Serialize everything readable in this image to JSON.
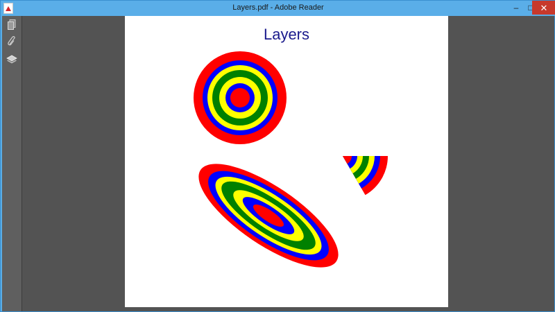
{
  "window": {
    "title": "Layers.pdf - Adobe Reader",
    "minimize_icon": "minimize-icon",
    "maximize_icon": "maximize-icon",
    "close_icon": "close-icon",
    "min_glyph": "–",
    "max_glyph": "□",
    "close_glyph": "✕"
  },
  "left_panel": {
    "buttons": [
      {
        "name": "page-thumbnails",
        "icon": "pages-icon"
      },
      {
        "name": "attachments",
        "icon": "paperclip-icon"
      },
      {
        "name": "layers",
        "icon": "layers-icon"
      }
    ]
  },
  "document": {
    "title": "Layers",
    "ring_colors": [
      "#ff0000",
      "#0000ff",
      "#ffff00",
      "#008000",
      "#ffff00",
      "#0000ff",
      "#ff0000"
    ]
  }
}
